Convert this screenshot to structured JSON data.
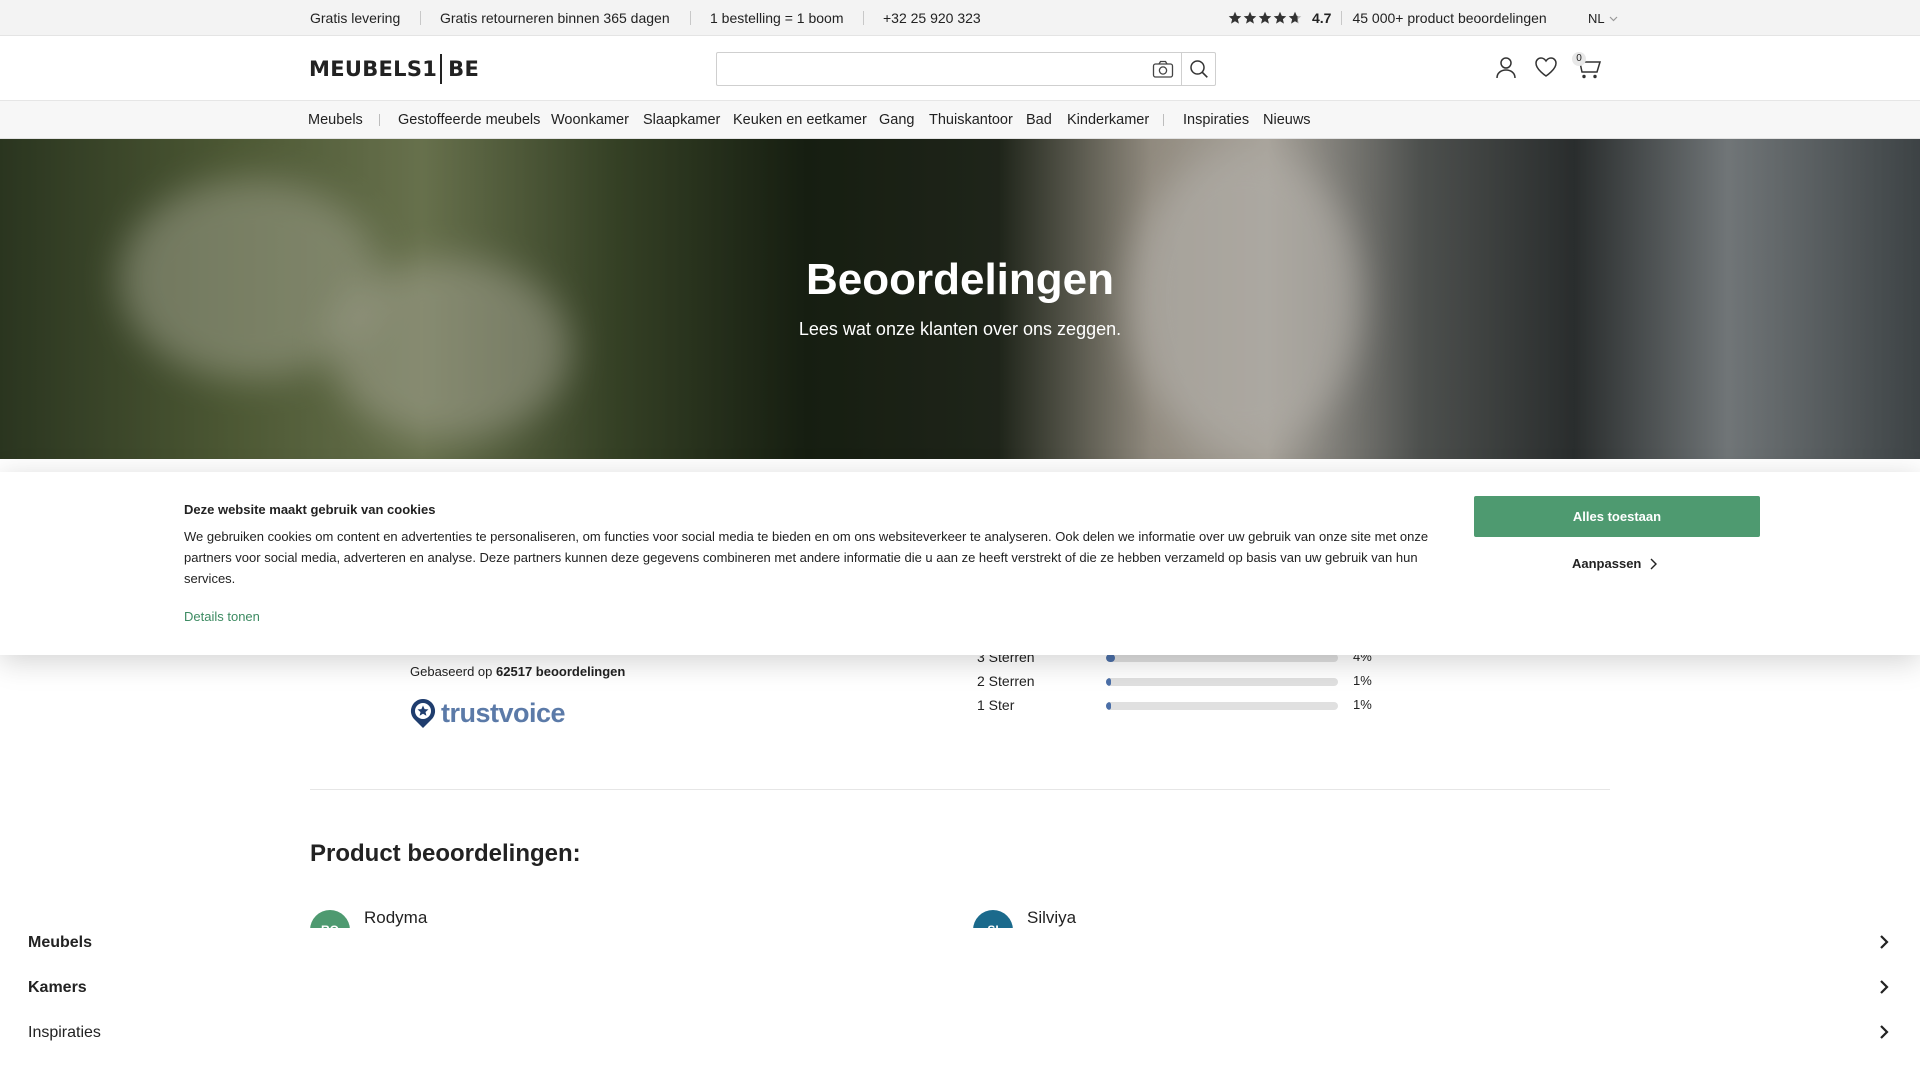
{
  "topbar": {
    "usps": [
      "Gratis levering",
      "Gratis retourneren binnen 365 dagen",
      "1 bestelling = 1 boom",
      "+32 25 920 323"
    ],
    "rating": "4.7",
    "reviews_label": "45 000+ product beoordelingen",
    "language": "NL"
  },
  "header": {
    "logo_left": "MEUBELS1",
    "logo_right": "BE",
    "search_placeholder": "",
    "cart_count": "0"
  },
  "nav": {
    "items": [
      "Meubels",
      "Gestoffeerde meubels",
      "Woonkamer",
      "Slaapkamer",
      "Keuken en eetkamer",
      "Gang",
      "Thuiskantoor",
      "Bad",
      "Kinderkamer",
      "Inspiraties",
      "Nieuws"
    ]
  },
  "hero": {
    "title": "Beoordelingen",
    "subtitle": "Lees wat onze klanten over ons zeggen."
  },
  "cookie": {
    "title": "Deze website maakt gebruik van cookies",
    "body": "We gebruiken cookies om content en advertenties te personaliseren, om functies voor social media te bieden en om ons websiteverkeer te analyseren. Ook delen we informatie over uw gebruik van onze site met onze partners voor social media, adverteren en analyse. Deze partners kunnen deze gegevens combineren met andere informatie die u aan ze heeft verstrekt of die ze hebben verzameld op basis van uw gebruik van hun services.",
    "details_link": "Details tonen",
    "allow_button": "Alles toestaan",
    "customize_button": "Aanpassen",
    "accent_color": "#4e9a70"
  },
  "summary": {
    "based_on_prefix": "Gebaseerd op",
    "based_on_count": "62517 beoordelingen",
    "provider": "trustvoice"
  },
  "distribution": [
    {
      "label": "3 Sterren",
      "percent": "4%",
      "fraction": 0.04
    },
    {
      "label": "2 Sterren",
      "percent": "1%",
      "fraction": 0.01
    },
    {
      "label": "1 Ster",
      "percent": "1%",
      "fraction": 0.01
    }
  ],
  "product_reviews": {
    "title": "Product beoordelingen:",
    "reviewers": [
      {
        "initials": "RO",
        "name": "Rodyma",
        "color": "#4e9a70"
      },
      {
        "initials": "SI",
        "name": "Silviya",
        "color": "#1b6a8c"
      }
    ]
  },
  "mobile_nav": {
    "items": [
      {
        "label": "Meubels",
        "bold": true
      },
      {
        "label": "Kamers",
        "bold": true
      },
      {
        "label": "Inspiraties",
        "bold": false
      }
    ]
  }
}
